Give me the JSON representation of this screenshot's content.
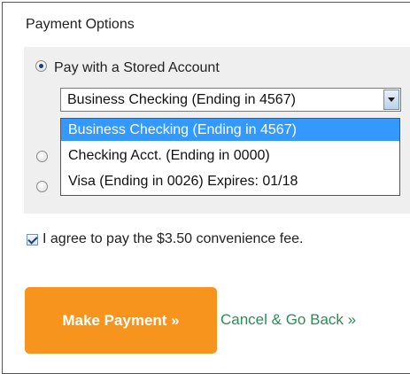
{
  "panel": {
    "title": "Payment Options"
  },
  "payment_methods": {
    "stored_account_label": "Pay with a Stored Account",
    "stored_account_selected": true
  },
  "account_select": {
    "value": "Business Checking (Ending in 4567)",
    "options": [
      "Business Checking (Ending in 4567)",
      "Checking Acct. (Ending in 0000)",
      "Visa (Ending in 0026) Expires: 01/18"
    ],
    "selected_index": 0
  },
  "agreement": {
    "label": "I agree to pay the $3.50 convenience fee.",
    "checked": true
  },
  "actions": {
    "pay_label": "Make Payment »",
    "cancel_label": "Cancel & Go Back »"
  },
  "colors": {
    "pay_button": "#f7941d",
    "cancel_link": "#2e8b57",
    "option_highlight": "#3399ff",
    "options_background": "#efefef"
  }
}
